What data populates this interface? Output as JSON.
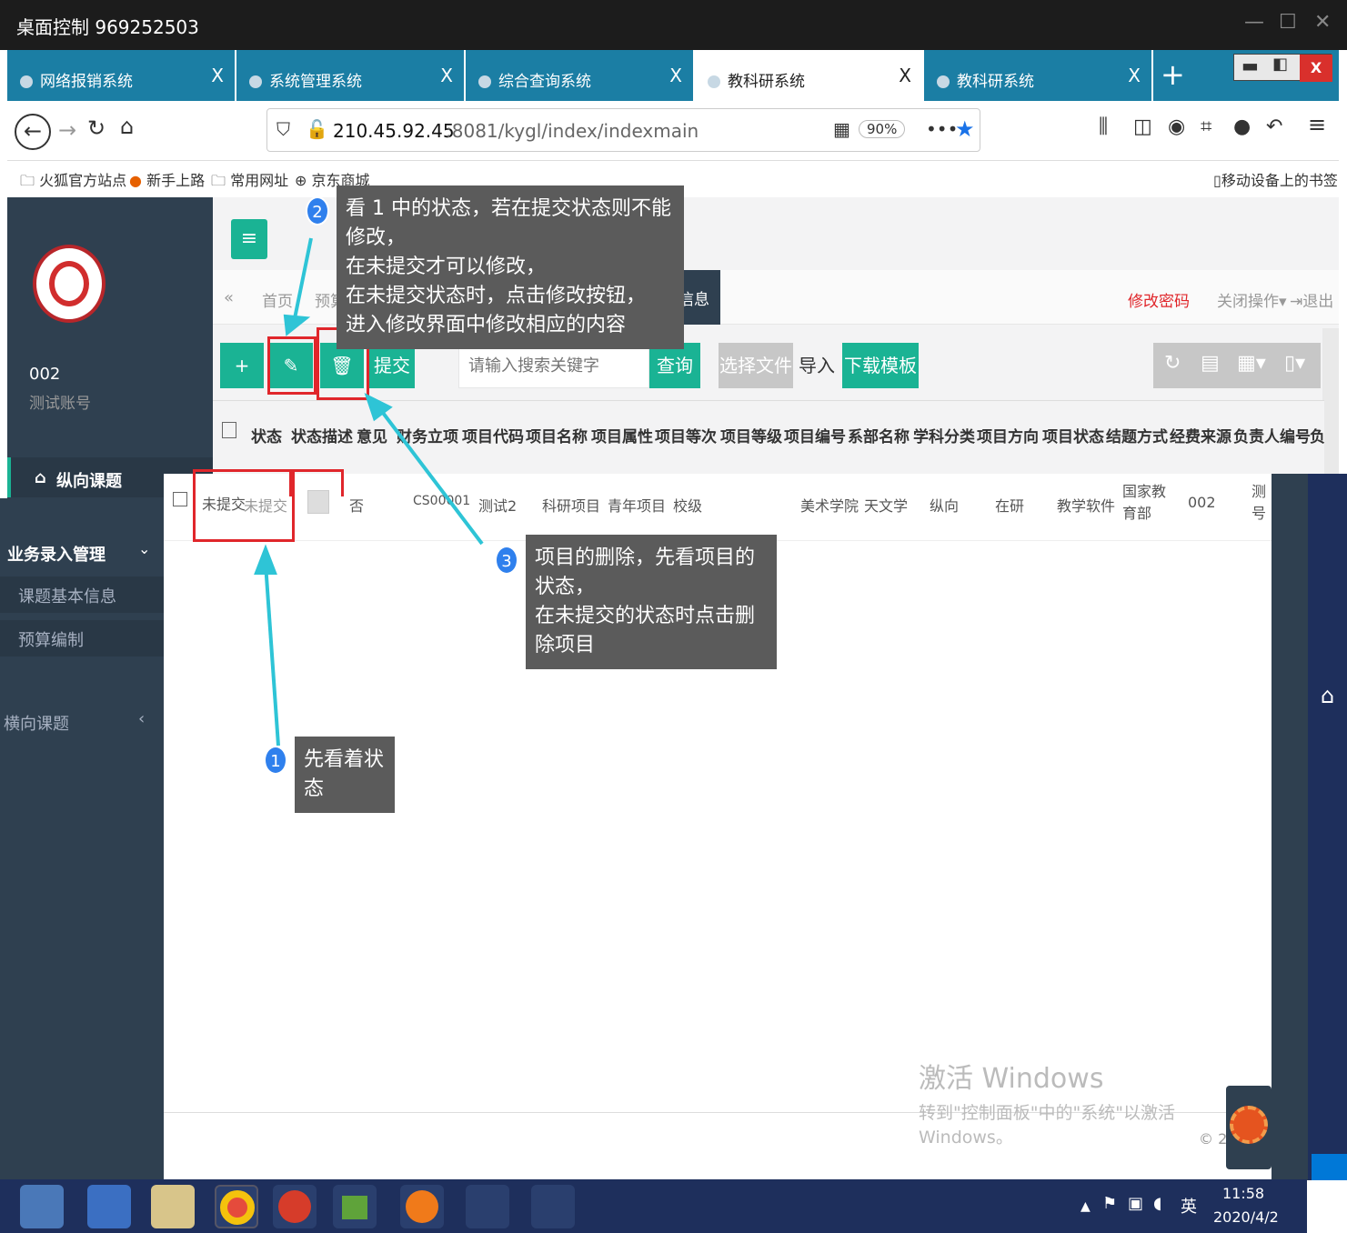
{
  "window": {
    "title": "桌面控制 969252503"
  },
  "tabs": [
    {
      "label": "网络报销系统",
      "close": "X"
    },
    {
      "label": "系统管理系统",
      "close": "X"
    },
    {
      "label": "综合查询系统",
      "close": "X"
    },
    {
      "label": "教科研系统",
      "close": "X"
    },
    {
      "label": "教科研系统",
      "close": "X"
    }
  ],
  "new_tab": "+",
  "url": {
    "host": "210.45.92.45",
    "rest": ":8081/kygl/index/indexmain",
    "zoom": "90%",
    "more": "•••"
  },
  "bookmarks": [
    "火狐官方站点",
    "新手上路",
    "常用网址",
    "京东商城"
  ],
  "mobile_bookmarks": "移动设备上的书签",
  "user": {
    "id": "002",
    "name": "测试账号"
  },
  "menu": {
    "vertical": "纵向课题",
    "business": "业务录入管理",
    "basic_info": "课题基本信息",
    "budget": "预算编制",
    "horizontal": "横向课题"
  },
  "page_tabs": {
    "home": "首页",
    "budget": "预算",
    "current": "课题基本信息"
  },
  "header_links": {
    "change_password": "修改密码",
    "close_ops": "关闭操作",
    "logout": "退出"
  },
  "toolbar": {
    "submit": "提交",
    "search_placeholder": "请输入搜索关键字",
    "query": "查询",
    "choose_file": "选择文件",
    "import": "导入",
    "download_template": "下载模板"
  },
  "table": {
    "headers": [
      "状态",
      "状态描述",
      "意见",
      "财务立项",
      "项目代码",
      "项目名称",
      "项目属性",
      "项目等次",
      "项目等级",
      "项目编号",
      "系部名称",
      "学科分类",
      "项目方向",
      "项目状态",
      "结题方式",
      "经费来源",
      "负责人编号",
      "负"
    ],
    "row": [
      "未提交",
      "未提交",
      "否",
      "CS00001",
      "测试2",
      "科研项目",
      "青年项目",
      "校级",
      "",
      "",
      "美术学院",
      "天文学",
      "纵向",
      "在研",
      "教学软件",
      "国家教育部",
      "002",
      "测号"
    ]
  },
  "tips": [
    {
      "n": "2",
      "lines": [
        "看 1 中的状态，若在提交状态则不能修改，",
        "在未提交才可以修改，",
        "在未提交状态时，点击修改按钮，",
        "进入修改界面中修改相应的内容"
      ]
    },
    {
      "n": "3",
      "lines": [
        "项目的删除，先看项目的状态，",
        "在未提交的状态时点击删除项目"
      ]
    },
    {
      "n": "1",
      "lines": [
        "先看着状态"
      ]
    }
  ],
  "watermark": {
    "line1": "激活 Windows",
    "line2": "转到\"控制面板\"中的\"系统\"以激活 Windows。",
    "copy": "© 20"
  },
  "taskbar": {
    "time": "11:58",
    "date": "2020/4/2",
    "ime": "英"
  }
}
